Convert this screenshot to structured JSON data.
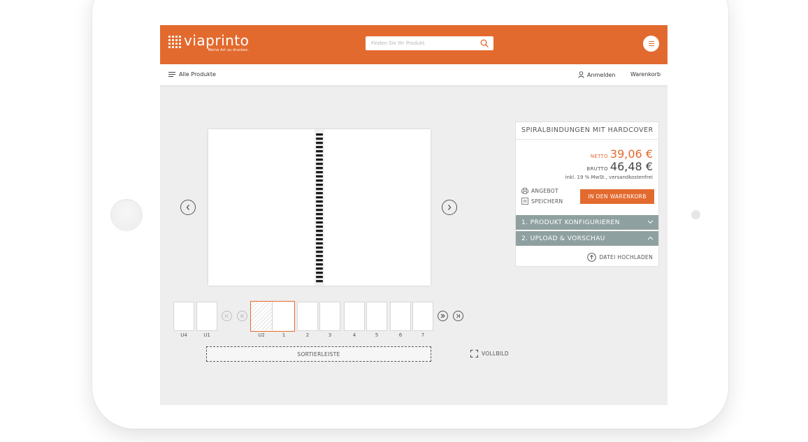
{
  "brand": {
    "name": "viaprinto",
    "claim": "Meine Art zu drucken.",
    "accent_color": "#e36a2e",
    "accordion_color": "#8fa0a0"
  },
  "search": {
    "placeholder": "Finden Sie Ihr Produkt",
    "icon": "search-icon"
  },
  "subnav": {
    "all_products": "Alle Produkte",
    "login": "Anmelden",
    "cart": "Warenkorb"
  },
  "product": {
    "title": "SPIRALBINDUNGEN MIT HARDCOVER",
    "net_label": "NETTO",
    "net_price": "39,06 €",
    "gross_label": "BRUTTO",
    "gross_price": "46,48 €",
    "vat_note": "inkl. 19 % MwSt., versandkostenfrei",
    "offer_label": "ANGEBOT",
    "save_label": "SPEICHERN",
    "cart_button": "IN DEN WARENKORB",
    "step1": "1. PRODUKT KONFIGURIEREN",
    "step2": "2. UPLOAD & VORSCHAU",
    "upload_label": "DATEI HOCHLADEN"
  },
  "thumbnails": {
    "left": [
      "U4",
      "U1"
    ],
    "selected": [
      "U2",
      "1"
    ],
    "right": [
      "2",
      "3",
      "4",
      "5",
      "6",
      "7"
    ]
  },
  "sort_bar": "SORTIERLEISTE",
  "fullscreen": "VOLLBILD"
}
